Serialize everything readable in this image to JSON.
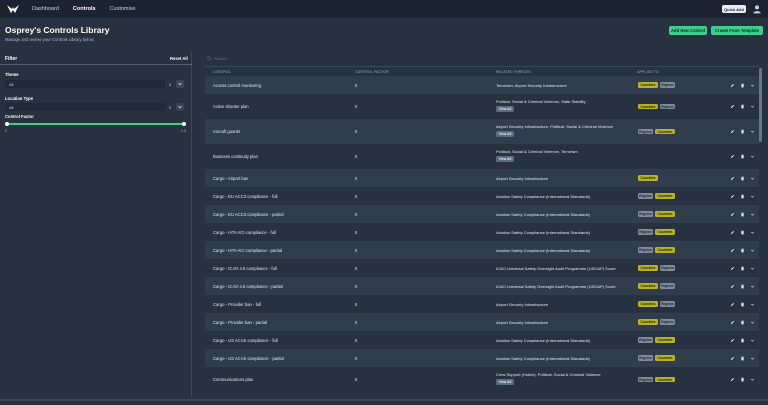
{
  "nav": {
    "items": [
      "Dashboard",
      "Controls",
      "Customise"
    ],
    "active_index": 1,
    "quick_add": "Quick Add"
  },
  "page": {
    "title": "Osprey's Controls Library",
    "subtitle": "Manage and review your Controls Library below.",
    "add_button": "Add New Control",
    "template_button": "Create From Template"
  },
  "filter": {
    "title": "Filter",
    "reset": "Reset All",
    "theme_label": "Theme",
    "theme_value": "All",
    "location_label": "Location Type",
    "location_value": "All",
    "clear_glyph": "x",
    "factor_label": "Control Factor",
    "factor_min": "0",
    "factor_max": "1.0",
    "factor_range": [
      0,
      1
    ]
  },
  "table": {
    "search_placeholder": "Search",
    "columns": [
      "CONTROL",
      "CONTROL FACTOR",
      "RELATED THREATS",
      "APPLIED TO"
    ],
    "view_all": "View All",
    "rows": [
      {
        "control": "Access control monitoring",
        "factor": "0",
        "threats": [
          "Terrorism, Airport Security Infrastructure"
        ],
        "view_all": false,
        "applied": [
          "Countries",
          "Regions"
        ]
      },
      {
        "control": "Active shooter plan",
        "factor": "0",
        "threats": [
          "Political, Social & Criminal Violence, State Stability"
        ],
        "view_all": true,
        "applied": [
          "Countries",
          "Regions"
        ]
      },
      {
        "control": "Aircraft guards",
        "factor": "0",
        "threats": [
          "Airport Security Infrastructure, Political, Social & Criminal Violence"
        ],
        "view_all": true,
        "applied": [
          "Regions",
          "Countries"
        ]
      },
      {
        "control": "Business continuity plan",
        "factor": "0",
        "threats": [
          "Political, Social & Criminal Violence, Terrorism"
        ],
        "view_all": true,
        "applied": []
      },
      {
        "control": "Cargo - Airport ban",
        "factor": "0",
        "threats": [
          "Airport Security Infrastructure"
        ],
        "view_all": false,
        "applied": [
          "Countries"
        ]
      },
      {
        "control": "Cargo - EU ACC3 compliance - full",
        "factor": "0",
        "threats": [
          "Aviation Safety Compliance (International Standards)"
        ],
        "view_all": false,
        "applied": [
          "Regions",
          "Countries"
        ]
      },
      {
        "control": "Cargo - EU ACC3 compliance - partial",
        "factor": "0",
        "threats": [
          "Aviation Safety Compliance (International Standards)"
        ],
        "view_all": false,
        "applied": [
          "Regions",
          "Countries"
        ]
      },
      {
        "control": "Cargo - IATA ACI compliance - full",
        "factor": "0",
        "threats": [
          "Aviation Safety Compliance (International Standards)"
        ],
        "view_all": false,
        "applied": [
          "Regions",
          "Countries"
        ]
      },
      {
        "control": "Cargo - IATA ACI compliance - partial",
        "factor": "0",
        "threats": [
          "Aviation Safety Compliance (International Standards)"
        ],
        "view_all": false,
        "applied": [
          "Regions",
          "Countries"
        ]
      },
      {
        "control": "Cargo - ICAO 4.6 compliance - full",
        "factor": "0",
        "threats": [
          "ICAO Universal Safety Oversight Audit Programme (USOAP) Score"
        ],
        "view_all": false,
        "applied": [
          "Countries",
          "Regions"
        ]
      },
      {
        "control": "Cargo - ICAO 4.6 compliance - partial",
        "factor": "0",
        "threats": [
          "ICAO Universal Safety Oversight Audit Programme (USOAP) Score"
        ],
        "view_all": false,
        "applied": [
          "Countries",
          "Regions"
        ]
      },
      {
        "control": "Cargo - Provider ban - full",
        "factor": "0",
        "threats": [
          "Airport Security Infrastructure"
        ],
        "view_all": false,
        "applied": [
          "Countries",
          "Regions"
        ]
      },
      {
        "control": "Cargo - Provider ban - partial",
        "factor": "0",
        "threats": [
          "Airport Security Infrastructure"
        ],
        "view_all": false,
        "applied": [
          "Countries",
          "Regions"
        ]
      },
      {
        "control": "Cargo - US ACAS compliance - full",
        "factor": "0",
        "threats": [
          "Aviation Safety Compliance (International Standards)"
        ],
        "view_all": false,
        "applied": [
          "Regions",
          "Countries"
        ]
      },
      {
        "control": "Cargo - US ACAS compliance - partial",
        "factor": "0",
        "threats": [
          "Aviation Safety Compliance (International Standards)"
        ],
        "view_all": false,
        "applied": [
          "Regions",
          "Countries"
        ]
      },
      {
        "control": "Communications plan",
        "factor": "0",
        "threats": [
          "Crew Support (Hotels), Political, Social & Criminal Violence"
        ],
        "view_all": true,
        "applied": [
          "Regions",
          "Countries"
        ]
      }
    ]
  },
  "colors": {
    "accent_green": "#3ecf8e",
    "countries_badge": "#b8b320",
    "regions_badge": "#7f8b9b",
    "topbar": "#1b2330",
    "background": "#273140"
  },
  "icons": [
    "osprey-logo-icon",
    "user-icon",
    "search-icon",
    "chevron-down-icon",
    "edit-icon",
    "delete-icon",
    "expand-icon"
  ]
}
